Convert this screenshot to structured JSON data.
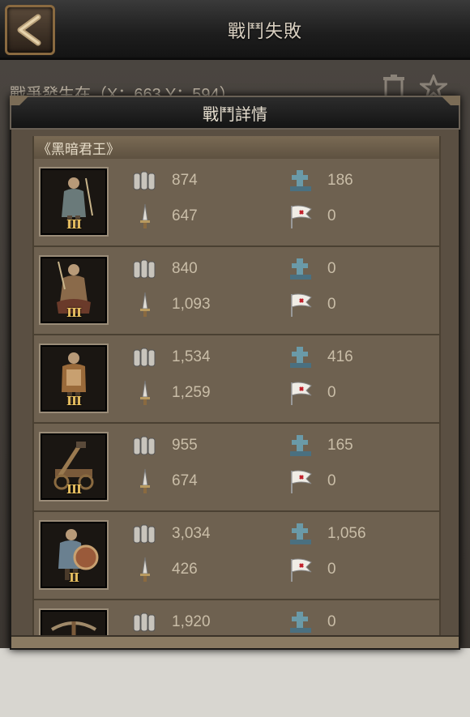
{
  "header": {
    "title": "戰鬥失敗"
  },
  "location": {
    "text": "戰爭發生在（X：663 Y：594）"
  },
  "modal": {
    "title": "戰鬥詳情",
    "side_label": "《黑暗君王》"
  },
  "units": [
    {
      "tier": "III",
      "troops": "874",
      "wounded": "647",
      "dead": "186",
      "survived": "0"
    },
    {
      "tier": "III",
      "troops": "840",
      "wounded": "1,093",
      "dead": "0",
      "survived": "0"
    },
    {
      "tier": "III",
      "troops": "1,534",
      "wounded": "1,259",
      "dead": "416",
      "survived": "0"
    },
    {
      "tier": "III",
      "troops": "955",
      "wounded": "674",
      "dead": "165",
      "survived": "0"
    },
    {
      "tier": "II",
      "troops": "3,034",
      "wounded": "426",
      "dead": "1,056",
      "survived": "0"
    },
    {
      "tier": "",
      "troops": "1,920",
      "wounded": "",
      "dead": "0",
      "survived": ""
    }
  ],
  "icons": {
    "back": "back-arrow-icon",
    "trash": "trash-icon",
    "favorite": "star-icon",
    "troops": "soldiers-icon",
    "wounded": "dagger-icon",
    "dead": "tombstone-icon",
    "survived": "flag-icon"
  },
  "colors": {
    "tier": "#e8c060",
    "value": "#c9bda7",
    "panel": "#6e6150"
  }
}
